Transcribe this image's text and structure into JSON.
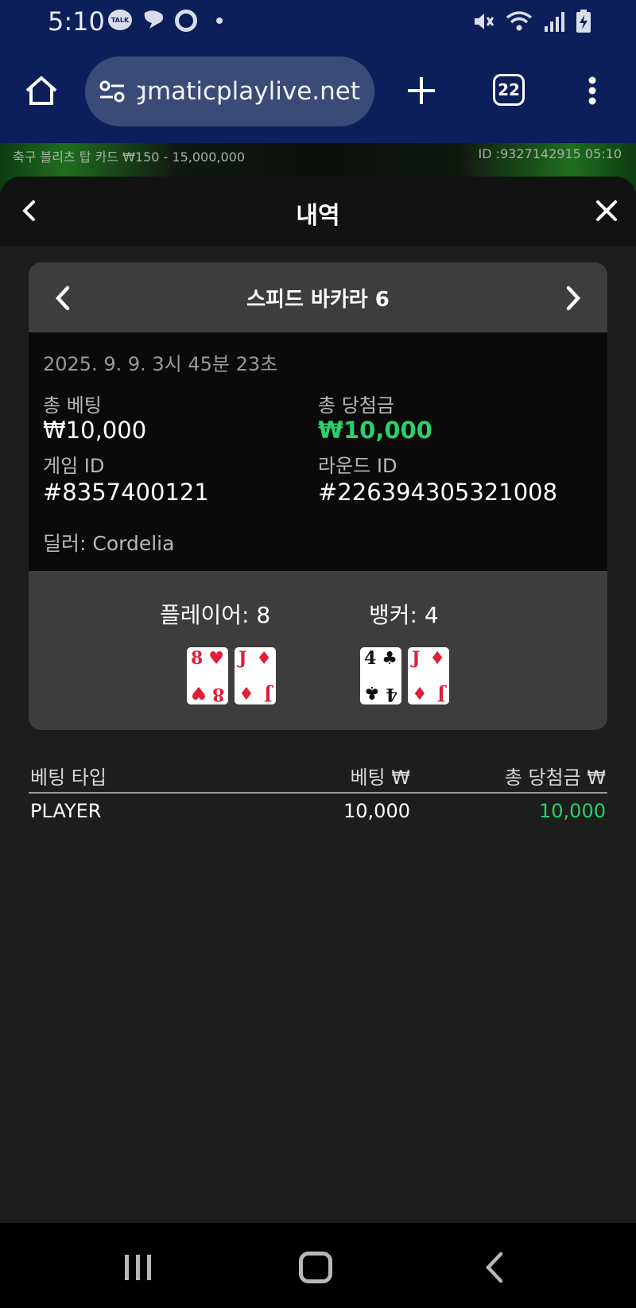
{
  "status_bar": {
    "time": "5:10",
    "talk_badge": "TALK",
    "icons": [
      "kakaotalk-icon",
      "chat-bubble-icon",
      "music-icon",
      "more-dot-icon",
      "mute-icon",
      "wifi-icon",
      "signal-icon",
      "battery-charging-icon"
    ]
  },
  "browser": {
    "url": "pragmaticplaylive.net",
    "tab_count": "22"
  },
  "game_strip": {
    "table_info": "축구 블리츠 탑 카드 ₩150 - 15,000,000",
    "session_id": "ID :9327142915 05:10"
  },
  "sheet": {
    "title": "내역"
  },
  "round": {
    "game_name": "스피드 바카라 6",
    "datetime": "2025. 9. 9. 3시 45분 23초",
    "total_bet_label": "총 베팅",
    "total_bet_value": "₩10,000",
    "total_win_label": "총 당첨금",
    "total_win_value": "₩10,000",
    "game_id_label": "게임 ID",
    "game_id_value": "#8357400121",
    "round_id_label": "라운드 ID",
    "round_id_value": "#226394305321008",
    "dealer": "딜러: Cordelia"
  },
  "result": {
    "player_label": "플레이어: 8",
    "banker_label": "뱅커: 4",
    "player_cards": [
      {
        "rank": "8",
        "suit": "♥",
        "color": "red"
      },
      {
        "rank": "J",
        "suit": "♦",
        "color": "red"
      }
    ],
    "banker_cards": [
      {
        "rank": "4",
        "suit": "♣",
        "color": "black"
      },
      {
        "rank": "J",
        "suit": "♦",
        "color": "red"
      }
    ]
  },
  "bets_table": {
    "headers": [
      "베팅 타입",
      "베팅 ₩",
      "총 당첨금 ₩"
    ],
    "rows": [
      {
        "type": "PLAYER",
        "bet": "10,000",
        "win": "10,000"
      }
    ]
  },
  "colors": {
    "win_green": "#2bd06a",
    "chrome_blue": "#0c1f5a",
    "card_red": "#e01e37"
  }
}
